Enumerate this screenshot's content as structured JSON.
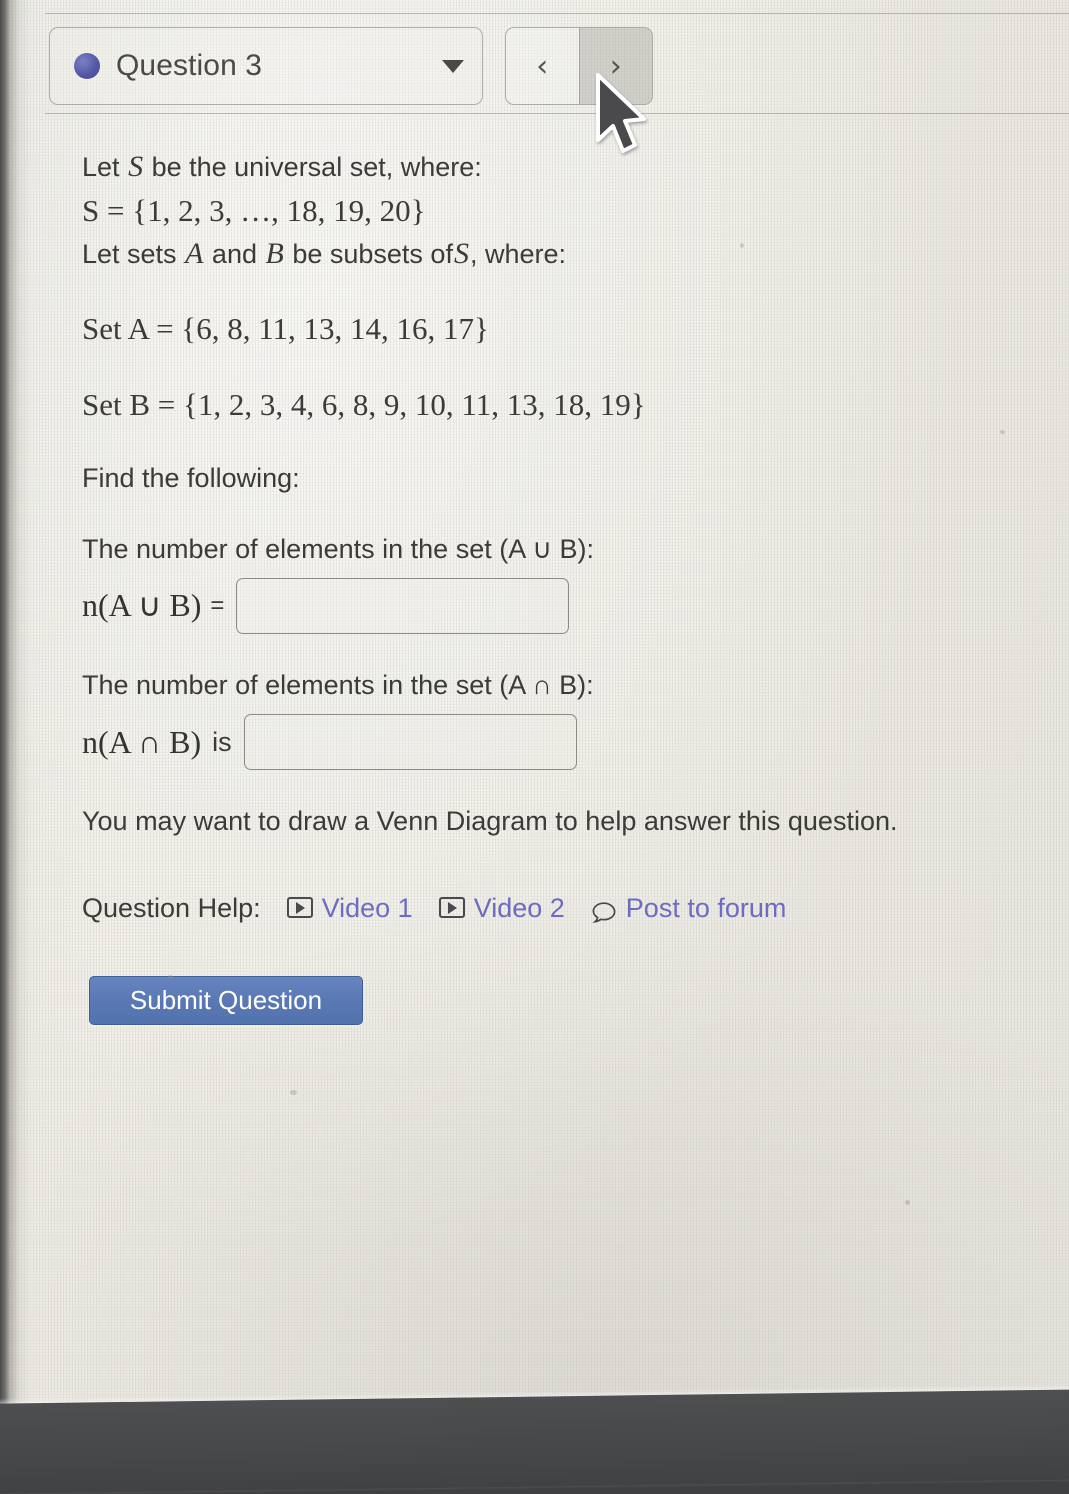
{
  "header": {
    "question_label": "Question 3",
    "dot_icon": "question-status-dot",
    "caret_icon": "chevron-down-icon",
    "prev_label": "‹",
    "next_label": "›",
    "accent_color": "#5156a4"
  },
  "problem": {
    "line1": "Let",
    "line1_var": "S",
    "line1_rest": "be the universal set, where:",
    "universal_set": "S = {1, 2, 3, …, 18, 19, 20}",
    "line3_prefix": "Let sets",
    "line3_varA": "A",
    "line3_and": "and",
    "line3_varB": "B",
    "line3_mid": "be subsets of",
    "line3_varS": "S",
    "line3_suffix": ", where:",
    "set_a": "Set A = {6, 8, 11, 13, 14, 16, 17}",
    "set_b": "Set B = {1, 2, 3, 4, 6, 8, 9, 10, 11, 13, 18, 19}",
    "find_following": "Find the following:",
    "prompt_union": "The number of elements in the set (A ∪ B):",
    "answer_label_union": "n(A ∪ B)",
    "union_connector": "=",
    "union_value": "",
    "union_placeholder": "",
    "prompt_intersection": "The number of elements in the set (A ∩ B):",
    "answer_label_intersection": "n(A ∩ B)",
    "intersection_connector": "is",
    "intersection_value": "",
    "intersection_placeholder": "",
    "hint": "You may want to draw a Venn Diagram to help answer this question."
  },
  "help": {
    "label": "Question Help:",
    "links": [
      {
        "text": "Video 1",
        "icon": "video-play-icon"
      },
      {
        "text": "Video 2",
        "icon": "video-play-icon"
      },
      {
        "text": "Post to forum",
        "icon": "speech-bubble-icon"
      }
    ],
    "link_color": "#6d6cc4"
  },
  "submit": {
    "label": "Submit Question",
    "color": "#5a78b4"
  },
  "cursor": {
    "icon": "mouse-pointer-arrow"
  }
}
